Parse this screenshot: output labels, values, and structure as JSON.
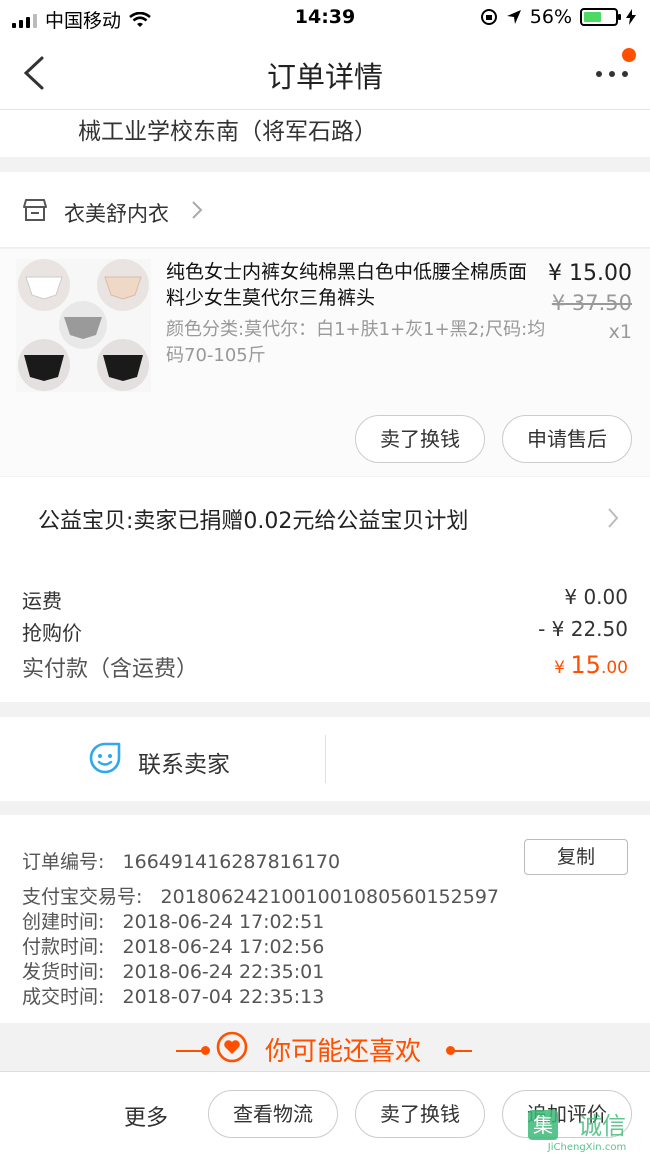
{
  "status": {
    "carrier": "中国移动",
    "time": "14:39",
    "battery": "56%"
  },
  "nav": {
    "title": "订单详情"
  },
  "address": {
    "tail": "械工业学校东南（将军石路）"
  },
  "shop": {
    "name": "衣美舒内衣"
  },
  "product": {
    "title": "纯色女士内裤女纯棉黑白色中低腰全棉质面料少女生莫代尔三角裤头",
    "specs": "颜色分类:莫代尔：白1+肤1+灰1+黑2;尺码:均码70-105斤",
    "price": "¥ 15.00",
    "original_price": "¥ 37.50",
    "quantity": "x1",
    "buttons": {
      "resell": "卖了换钱",
      "aftersale": "申请售后"
    }
  },
  "charity": {
    "text": "公益宝贝:卖家已捐赠0.02元给公益宝贝计划"
  },
  "costs": {
    "shipping_label": "运费",
    "shipping": "¥ 0.00",
    "flash_label": "抢购价",
    "flash": "- ¥ 22.50",
    "paid_label": "实付款（含运费）",
    "paid_currency": "¥ ",
    "paid_int": "15",
    "paid_dec": ".00"
  },
  "contact": {
    "label": "联系卖家"
  },
  "info": {
    "order_no": "订单编号:   166491416287816170",
    "copy": "复制",
    "alipay": "支付宝交易号:   2018062421001001080560152597",
    "created": "创建时间:   2018-06-24 17:02:51",
    "paid": "付款时间:   2018-06-24 17:02:56",
    "shipped": "发货时间:   2018-06-24 22:35:01",
    "completed": "成交时间:   2018-07-04 22:35:13"
  },
  "recommend": {
    "title": "你可能还喜欢"
  },
  "bottom": {
    "more": "更多",
    "logistics": "查看物流",
    "resell": "卖了换钱",
    "review": "追加评价"
  },
  "watermark": {
    "text": "JiChengXin.com",
    "cn": "集诚信"
  },
  "colors": {
    "accent": "#ff5000",
    "battery": "#4cd964",
    "contact_icon": "#2fa8f0"
  }
}
